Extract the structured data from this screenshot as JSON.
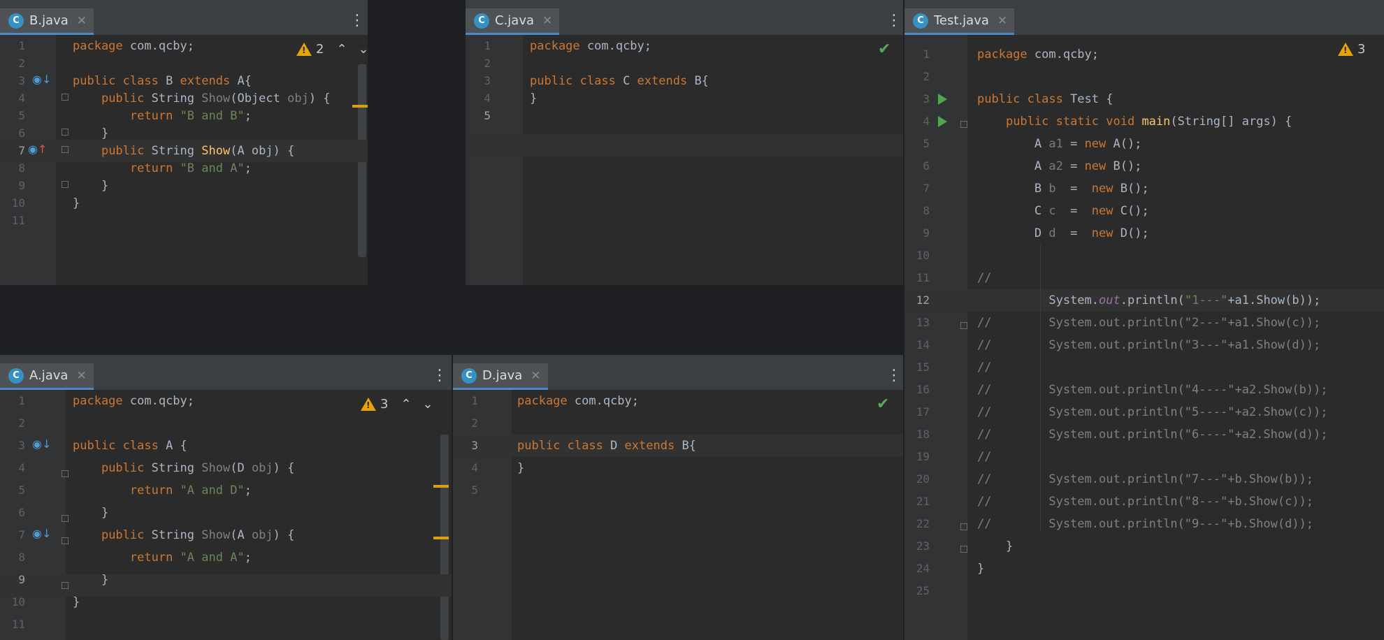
{
  "panes": {
    "b": {
      "tab": "B.java",
      "icon_letter": "C",
      "warn_count": "2",
      "lines": [
        "package com.qcby;",
        "",
        "public class B extends A{",
        "    public String Show(Object obj) {",
        "        return \"B and B\";",
        "    }",
        "    public String Show(A obj) {",
        "        return \"B and A\";",
        "    }",
        "}",
        ""
      ]
    },
    "c": {
      "tab": "C.java",
      "icon_letter": "C"
    },
    "test": {
      "tab": "Test.java",
      "icon_letter": "C",
      "warn_count": "3"
    },
    "a": {
      "tab": "A.java",
      "icon_letter": "C",
      "warn_count": "3"
    },
    "d": {
      "tab": "D.java",
      "icon_letter": "C"
    }
  },
  "gutter_icons": {
    "implemented": "implemented-icon",
    "overrides": "overrides-icon",
    "run": "run-icon"
  },
  "colors": {
    "keyword": "#cc7832",
    "string": "#6a8759",
    "method": "#ffc66d",
    "text": "#a9b7c6",
    "warning": "#e5a50a",
    "accent": "#4a88c7"
  }
}
